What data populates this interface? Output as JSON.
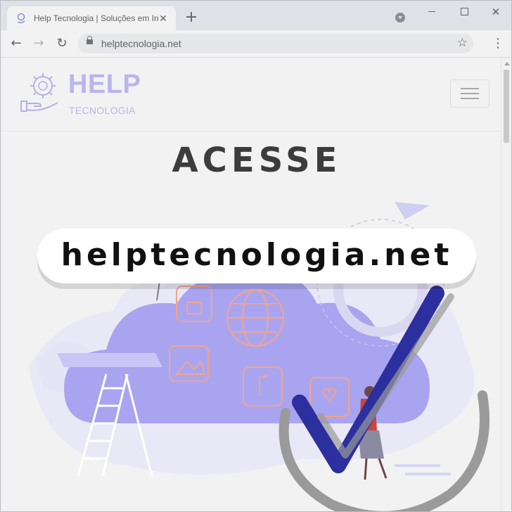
{
  "browser": {
    "tab": {
      "title": "Help Tecnologia | Soluções em In",
      "close_glyph": "✕",
      "favicon_icon": "brain-gear-icon"
    },
    "new_tab_glyph": "+",
    "window": {
      "close_glyph": "✕"
    },
    "nav": {
      "back_glyph": "←",
      "forward_glyph": "→",
      "reload_glyph": "↻",
      "menu_glyph": "⋮"
    },
    "url": "helptecnologia.net",
    "bookmark_glyph": "☆"
  },
  "site": {
    "brand": {
      "title": "HELP",
      "subtitle": "TECNOLOGIA",
      "color": "#b9b5ee"
    },
    "hero": {
      "headline": "ACESSE",
      "url_text": "helptecnologia.net"
    }
  },
  "colors": {
    "illustration_purple": "#a9a4f0",
    "illustration_orange": "#f3a38a",
    "check_navy": "#2c2f9e",
    "check_gray": "#9a9a9a"
  }
}
